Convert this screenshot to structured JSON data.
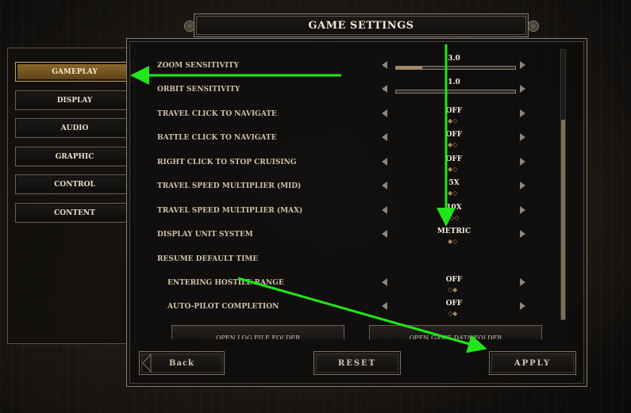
{
  "title": "GAME SETTINGS",
  "sidebar": {
    "items": [
      {
        "label": "GAMEPLAY",
        "active": true
      },
      {
        "label": "DISPLAY",
        "active": false
      },
      {
        "label": "AUDIO",
        "active": false
      },
      {
        "label": "GRAPHIC",
        "active": false
      },
      {
        "label": "CONTROL",
        "active": false
      },
      {
        "label": "CONTENT",
        "active": false
      }
    ]
  },
  "settings": [
    {
      "label": "ZOOM SENSITIVITY",
      "value": "3.0",
      "type": "slider",
      "level": 0.22
    },
    {
      "label": "ORBIT SENSITIVITY",
      "value": "1.0",
      "type": "slider",
      "level": 0.0
    },
    {
      "label": "TRAVEL CLICK TO NAVIGATE",
      "value": "OFF",
      "type": "toggle",
      "dots": "◆◇"
    },
    {
      "label": "BATTLE CLICK TO NAVIGATE",
      "value": "OFF",
      "type": "toggle",
      "dots": "◆◇"
    },
    {
      "label": "RIGHT CLICK TO STOP CRUISING",
      "value": "OFF",
      "type": "toggle",
      "dots": "◆◇"
    },
    {
      "label": "TRAVEL SPEED MULTIPLIER (MID)",
      "value": "5X",
      "type": "toggle",
      "dots": "◆◇"
    },
    {
      "label": "TRAVEL SPEED MULTIPLIER (MAX)",
      "value": "10X",
      "type": "toggle",
      "dots": "◇◇◇"
    },
    {
      "label": "DISPLAY UNIT SYSTEM",
      "value": "METRIC",
      "type": "toggle",
      "dots": "◆◇"
    },
    {
      "label": "RESUME DEFAULT TIME",
      "value": "",
      "type": "header"
    },
    {
      "label": "ENTERING HOSTILE RANGE",
      "value": "OFF",
      "type": "toggle",
      "sub": true,
      "dots": "◇◆"
    },
    {
      "label": "AUTO-PILOT COMPLETION",
      "value": "OFF",
      "type": "toggle",
      "sub": true,
      "dots": "◇◆"
    }
  ],
  "folder_buttons": {
    "log": "OPEN LOG FILE FOLDER",
    "data": "OPEN GAME DATA FOLDER"
  },
  "footer": {
    "back": "Back",
    "reset": "RESET",
    "apply": "APPLY"
  },
  "colors": {
    "accent": "#8d6a2c",
    "annotation": "#22e61a",
    "text": "#cfc2a8"
  }
}
